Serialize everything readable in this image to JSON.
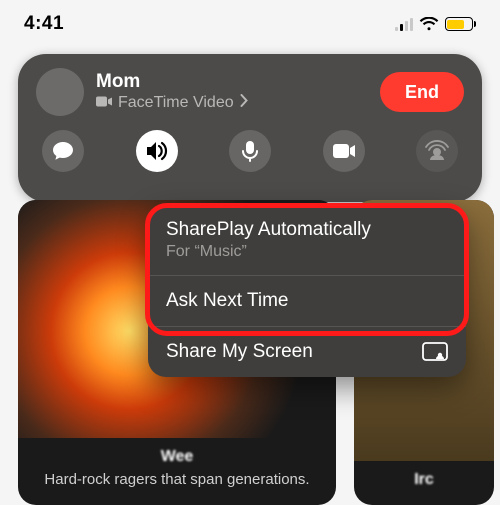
{
  "status": {
    "time": "4:41"
  },
  "call": {
    "name": "Mom",
    "type": "FaceTime Video",
    "end_label": "End",
    "controls": {
      "messages": "messages-icon",
      "speaker": "speaker-icon",
      "mute": "microphone-icon",
      "camera": "video-icon",
      "shareplay": "shareplay-icon"
    },
    "speaker_active": true
  },
  "menu": {
    "items": [
      {
        "label": "SharePlay Automatically",
        "sub": "For “Music”"
      },
      {
        "label": "Ask Next Time"
      },
      {
        "label": "Share My Screen",
        "icon": "screen-share-icon"
      }
    ]
  },
  "cards": [
    {
      "title": "Wee",
      "subtitle": "Hard-rock ragers that span generations."
    },
    {
      "title": "Irc"
    }
  ],
  "colors": {
    "end_button": "#ff3b30",
    "battery_fill": "#ffcc00",
    "highlight": "#ff1a1a"
  }
}
